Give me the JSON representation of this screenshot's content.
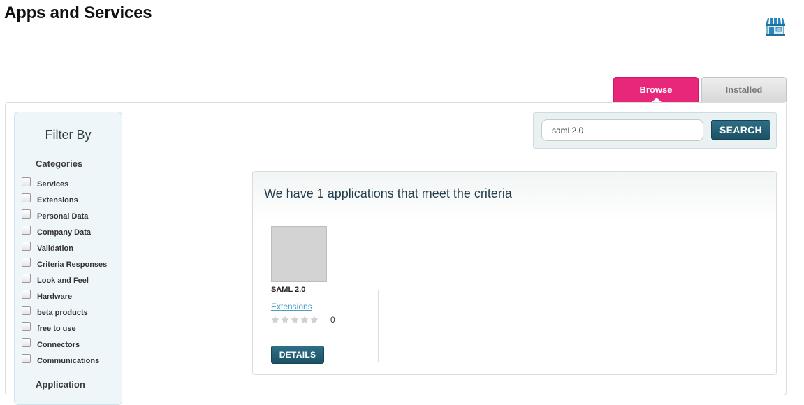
{
  "header": {
    "title": "Apps and Services",
    "store_icon": "storefront-icon"
  },
  "tabs": [
    {
      "label": "Browse",
      "active": true
    },
    {
      "label": "Installed",
      "active": false
    }
  ],
  "filter": {
    "title": "Filter By",
    "categories_heading": "Categories",
    "categories": [
      {
        "label": "Services",
        "checked": false
      },
      {
        "label": "Extensions",
        "checked": false
      },
      {
        "label": "Personal Data",
        "checked": false
      },
      {
        "label": "Company Data",
        "checked": false
      },
      {
        "label": "Validation",
        "checked": false
      },
      {
        "label": "Criteria Responses",
        "checked": false
      },
      {
        "label": "Look and Feel",
        "checked": false
      },
      {
        "label": "Hardware",
        "checked": false
      },
      {
        "label": "beta products",
        "checked": false
      },
      {
        "label": "free to use",
        "checked": false
      },
      {
        "label": "Connectors",
        "checked": false
      },
      {
        "label": "Communications",
        "checked": false
      }
    ],
    "next_heading": "Application"
  },
  "search": {
    "value": "saml 2.0",
    "button_label": "SEARCH"
  },
  "results": {
    "heading": "We have 1 applications that meet the criteria",
    "apps": [
      {
        "name": "SAML 2.0",
        "category": "Extensions",
        "rating": 0,
        "rating_max": 5,
        "rating_count": "0",
        "details_label": "DETAILS"
      }
    ]
  },
  "colors": {
    "accent_pink": "#e8267a",
    "button_teal": "#1f5a70",
    "link_blue": "#4aa0c9"
  }
}
